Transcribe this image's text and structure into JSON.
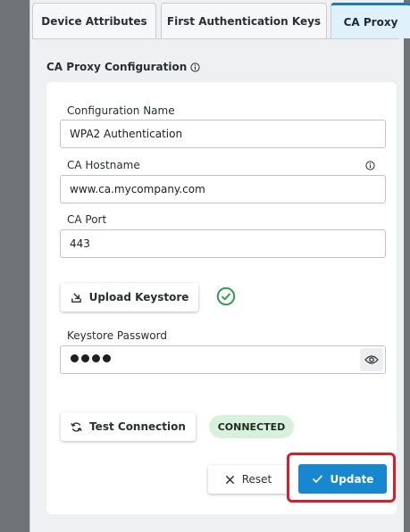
{
  "tabs": [
    {
      "label": "Device Attributes"
    },
    {
      "label": "First Authentication Keys"
    },
    {
      "label": "CA Proxy"
    }
  ],
  "section": {
    "title": "CA Proxy Configuration",
    "info_icon": "info-icon"
  },
  "form": {
    "config_name": {
      "label": "Configuration Name",
      "value": "WPA2 Authentication"
    },
    "hostname": {
      "label": "CA Hostname",
      "value": "www.ca.mycompany.com",
      "info_icon": "info-icon"
    },
    "port": {
      "label": "CA Port",
      "value": "443"
    },
    "upload": {
      "label": "Upload Keystore",
      "icon": "upload-icon",
      "status_icon": "check-circle-icon"
    },
    "password": {
      "label": "Keystore Password",
      "masked_length": 4,
      "toggle_icon": "eye-icon"
    },
    "test": {
      "label": "Test Connection",
      "icon": "refresh-icon",
      "status": "CONNECTED"
    }
  },
  "actions": {
    "reset_label": "Reset",
    "update_label": "Update"
  },
  "colors": {
    "accent": "#1787d0",
    "success": "#2e9e4a",
    "highlight": "#d81e2a"
  }
}
